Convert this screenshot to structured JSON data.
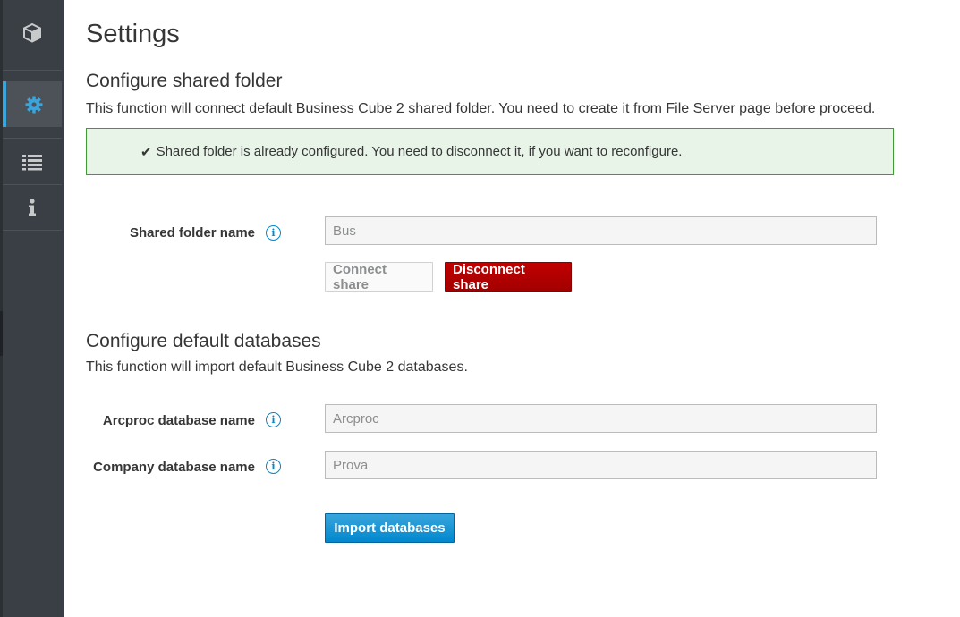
{
  "sidebar": {
    "items": [
      {
        "icon": "cube-icon"
      },
      {
        "icon": "gear-icon",
        "active": true
      },
      {
        "icon": "list-icon"
      },
      {
        "icon": "info-icon"
      }
    ],
    "accent": "#39a5dc"
  },
  "page": {
    "title": "Settings"
  },
  "shared_folder": {
    "heading": "Configure shared folder",
    "description": "This function will connect default Business Cube 2 shared folder. You need to create it from File Server page before proceed.",
    "alert": "Shared folder is already configured. You need to disconnect it, if you want to reconfigure.",
    "field_label": "Shared folder name",
    "field_value": "Bus",
    "connect_label": "Connect share",
    "disconnect_label": "Disconnect share"
  },
  "databases": {
    "heading": "Configure default databases",
    "description": "This function will import default Business Cube 2 databases.",
    "arcproc_label": "Arcproc database name",
    "arcproc_value": "Arcproc",
    "company_label": "Company database name",
    "company_value": "Prova",
    "import_label": "Import databases"
  },
  "colors": {
    "danger": "#c00000",
    "primary": "#0088ce",
    "success_border": "#3f9c35",
    "success_bg": "#e9f4e9"
  }
}
